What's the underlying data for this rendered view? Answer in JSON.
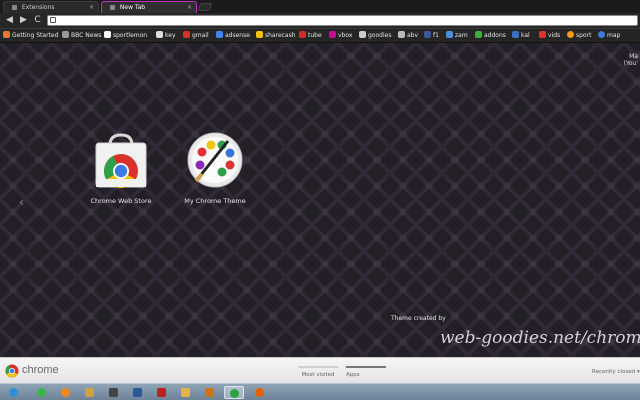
{
  "tabs": [
    {
      "label": "Extensions",
      "close": "×"
    },
    {
      "label": "New Tab",
      "close": "×"
    }
  ],
  "toolbar": {
    "back": "◀",
    "forward": "▶",
    "reload": "C",
    "address_value": ""
  },
  "bookmarks": [
    {
      "label": "Getting Started",
      "color": "#e8762b"
    },
    {
      "label": "BBC News",
      "color": "#9a9a9a"
    },
    {
      "label": "sportlemon",
      "color": "#ffffff"
    },
    {
      "label": "key",
      "color": "#dddddd"
    },
    {
      "label": "gmail",
      "color": "#d93025"
    },
    {
      "label": "adsense",
      "color": "#4285f4"
    },
    {
      "label": "sharecash",
      "color": "#f4c20d"
    },
    {
      "label": "tube",
      "color": "#d62b2b"
    },
    {
      "label": "vbox",
      "color": "#c0108f"
    },
    {
      "label": "goodies",
      "color": "#cccccc"
    },
    {
      "label": "abv",
      "color": "#bbbbbb"
    },
    {
      "label": "f1",
      "color": "#3b5998"
    },
    {
      "label": "zam",
      "color": "#4a90d9"
    },
    {
      "label": "addons",
      "color": "#38b03e"
    },
    {
      "label": "kal",
      "color": "#3a6fc4"
    },
    {
      "label": "vids",
      "color": "#e33030"
    },
    {
      "label": "sport",
      "color": "#f29a18"
    },
    {
      "label": "map",
      "color": "#3b7bd9"
    }
  ],
  "ntp": {
    "right_text": "Ma\n(You'",
    "left_arrow": "‹",
    "apps": [
      {
        "label": "Chrome Web Store"
      },
      {
        "label": "My Chrome Theme"
      }
    ],
    "theme_credit": "Theme created by",
    "theme_signature": "web-goodies.net/chrom"
  },
  "footer": {
    "logo_text": "chrome",
    "tabs": [
      {
        "label": "Most visited",
        "active": false
      },
      {
        "label": "Apps",
        "active": true
      }
    ],
    "recently_closed": "Recently closed ▾"
  },
  "taskbar": [
    {
      "icon": "windows-orb-icon",
      "color": "#2f8fd6"
    },
    {
      "icon": "whatsapp-icon",
      "color": "#3ab54a"
    },
    {
      "icon": "media-player-icon",
      "color": "#f08a1c"
    },
    {
      "icon": "explorer-icon",
      "color": "#c9a24b"
    },
    {
      "icon": "app-icon",
      "color": "#444"
    },
    {
      "icon": "word-icon",
      "color": "#2b5797"
    },
    {
      "icon": "filezilla-icon",
      "color": "#b22"
    },
    {
      "icon": "folder-icon",
      "color": "#e0b44c"
    },
    {
      "icon": "winamp-icon",
      "color": "#c9761e"
    },
    {
      "icon": "chrome-icon",
      "color": "#2aa142"
    },
    {
      "icon": "firefox-icon",
      "color": "#e66000"
    }
  ]
}
